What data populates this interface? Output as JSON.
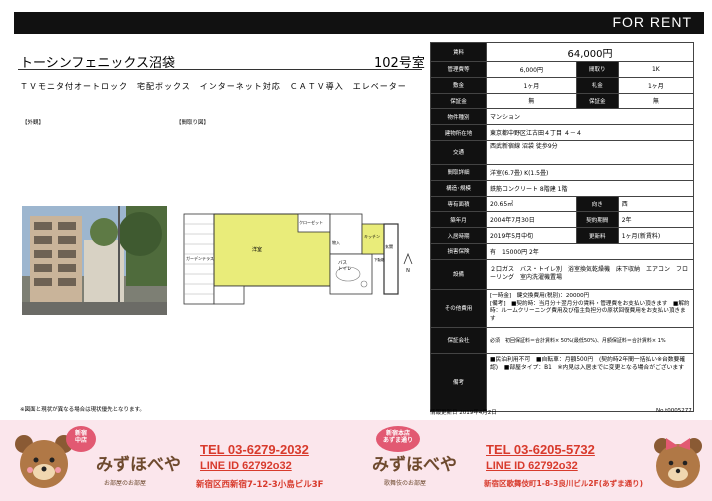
{
  "header": {
    "for_rent": "FOR RENT"
  },
  "property": {
    "name": "トーシンフェニックス沼袋",
    "room": "102号室",
    "features": "ＴＶモニタ付オートロック　宅配ボックス　インターネット対応　ＣＡＴＶ導入　エレベーター"
  },
  "labels": {
    "exterior": "【外観】",
    "layout": "【間取り図】"
  },
  "floorplan": {
    "garden": "ガーデンテラス",
    "western_room": "洋室",
    "closet": "クローゼット",
    "kitchen": "キッチン",
    "storage": "物入",
    "bath": "バス\nトイレ",
    "shoe": "下駄箱",
    "entrance": "玄関"
  },
  "note": "※図面と現状が異なる場合は現状優先となります。",
  "spec": {
    "rent_label": "賃料",
    "rent": "64,000円",
    "mgmt_label": "管理費等",
    "mgmt": "6,000円",
    "layout_label": "間取り",
    "layout": "1K",
    "deposit_label": "敷金",
    "deposit": "1ヶ月",
    "key_label": "礼金",
    "key": "1ヶ月",
    "guarantee_label": "保証金",
    "guarantee": "無",
    "guarantee2_label": "保証金",
    "guarantee2": "無",
    "type_label": "物件種別",
    "type": "マンション",
    "address_label": "建物所在地",
    "address": "東京都中野区江古田４丁目 ４－４",
    "transport_label": "交通",
    "transport": "西武新宿線 沼袋 徒歩9分",
    "rooms_label": "間取詳細",
    "rooms": "洋室(6.7畳) K(1.5畳)",
    "structure_label": "構造･規模",
    "structure": "鉄筋コンクリート 8階建 1階",
    "area_label": "専有面積",
    "area": "20.65㎡",
    "direction_label": "向き",
    "direction": "西",
    "built_label": "築年月",
    "built": "2004年7月30日",
    "contract_label": "契約期間",
    "contract": "2年",
    "movein_label": "入居時期",
    "movein": "2019年5月中旬",
    "renewal_label": "更新料",
    "renewal": "1ヶ月(新賃料)",
    "parking_label": "損害保険",
    "parking": "有　15000円 2年",
    "facilities_label": "設備",
    "facilities": "２口ガス　バス・トイレ別　浴室換気乾燥機　床下収納　エアコン　フローリング　室内洗濯機置場",
    "other_label": "その他費用",
    "other": "[一時金]　鍵交換費用(税別)：20000円\n[備考]　■契約時：当月分＋翌月分の賃料・管理費をお支払い頂きます　■解約時：ルームクリーニング費用及び借主負担分の原状回復費用をお支払い頂きます",
    "guarantor_label": "保証会社",
    "guarantor": "必須　初回保証料＝合計賃料× 50%(最低50%)、月額保証料＝合計賃料× 1%",
    "remarks_label": "備考",
    "remarks": "■民泊利用不可　■自転車：月額500円　(契約時2年間一括払い※台数要確認)　■部屋タイプ：B1　※内見は入居までに変更となる場合がございます"
  },
  "updated": "情報更新日 2019年4月2日",
  "ref_no": "No.t0005277",
  "banner": {
    "left": {
      "badge": "新宿\n中店",
      "brand": "みずほべや",
      "tagline": "お部屋のお部屋",
      "tel": "TEL 03-6279-2032",
      "line": "LINE ID 62792o32",
      "address": "新宿区西新宿7-12-3小島ビル3F"
    },
    "right": {
      "badge": "新宿本店\nあずま通り",
      "brand": "みずほべや",
      "tagline": "歌舞伎のお部屋",
      "tel": "TEL 03-6205-5732",
      "line": "LINE ID 62792o32",
      "address": "新宿区歌舞伎町1-8-3良川ビル2F(あずま通り)"
    }
  },
  "colors": {
    "accent": "#d83a2c",
    "banner_bg": "#fbe6ec",
    "header_bg": "#111111",
    "floor_yellow": "#e9ec7a"
  }
}
